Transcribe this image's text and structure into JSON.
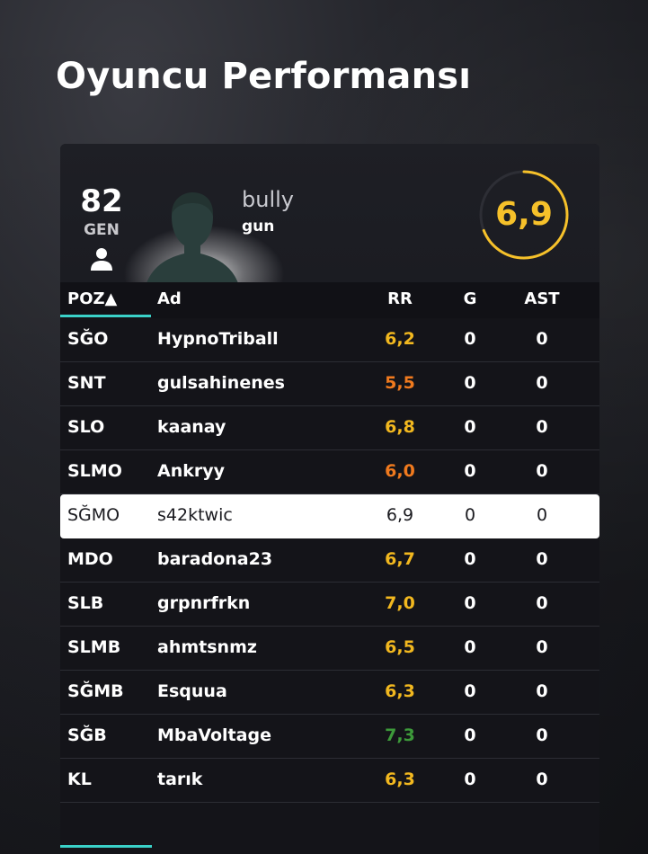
{
  "page": {
    "title": "Oyuncu Performansı"
  },
  "player": {
    "overall": "82",
    "overall_label": "GEN",
    "name": "bully",
    "sub": "gun",
    "score": "6,9",
    "score_fraction": 0.69
  },
  "table": {
    "headers": {
      "pos": "POZ▲",
      "name": "Ad",
      "rr": "RR",
      "g": "G",
      "ast": "AST"
    },
    "rows": [
      {
        "pos": "SĞO",
        "name": "HypnoTriball",
        "rr": "6,2",
        "rr_color": "#f2b81f",
        "g": "0",
        "ast": "0",
        "highlight": false
      },
      {
        "pos": "SNT",
        "name": "gulsahinenes",
        "rr": "5,5",
        "rr_color": "#f07a1e",
        "g": "0",
        "ast": "0",
        "highlight": false
      },
      {
        "pos": "SLO",
        "name": "kaanay",
        "rr": "6,8",
        "rr_color": "#f2b81f",
        "g": "0",
        "ast": "0",
        "highlight": false
      },
      {
        "pos": "SLMO",
        "name": "Ankryy",
        "rr": "6,0",
        "rr_color": "#f07a1e",
        "g": "0",
        "ast": "0",
        "highlight": false
      },
      {
        "pos": "SĞMO",
        "name": "s42ktwic",
        "rr": "6,9",
        "rr_color": "#1a1a1f",
        "g": "0",
        "ast": "0",
        "highlight": true
      },
      {
        "pos": "MDO",
        "name": "baradona23",
        "rr": "6,7",
        "rr_color": "#f2b81f",
        "g": "0",
        "ast": "0",
        "highlight": false
      },
      {
        "pos": "SLB",
        "name": "grpnrfrkn",
        "rr": "7,0",
        "rr_color": "#f2b81f",
        "g": "0",
        "ast": "0",
        "highlight": false
      },
      {
        "pos": "SLMB",
        "name": "ahmtsnmz",
        "rr": "6,5",
        "rr_color": "#f2b81f",
        "g": "0",
        "ast": "0",
        "highlight": false
      },
      {
        "pos": "SĞMB",
        "name": "Esquua",
        "rr": "6,3",
        "rr_color": "#f2b81f",
        "g": "0",
        "ast": "0",
        "highlight": false
      },
      {
        "pos": "SĞB",
        "name": "MbaVoltage",
        "rr": "7,3",
        "rr_color": "#3d9a3a",
        "g": "0",
        "ast": "0",
        "highlight": false
      },
      {
        "pos": "KL",
        "name": "tarık",
        "rr": "6,3",
        "rr_color": "#f2b81f",
        "g": "0",
        "ast": "0",
        "highlight": false
      }
    ]
  },
  "colors": {
    "accent": "#3ad1c8",
    "score": "#f6c12a"
  }
}
